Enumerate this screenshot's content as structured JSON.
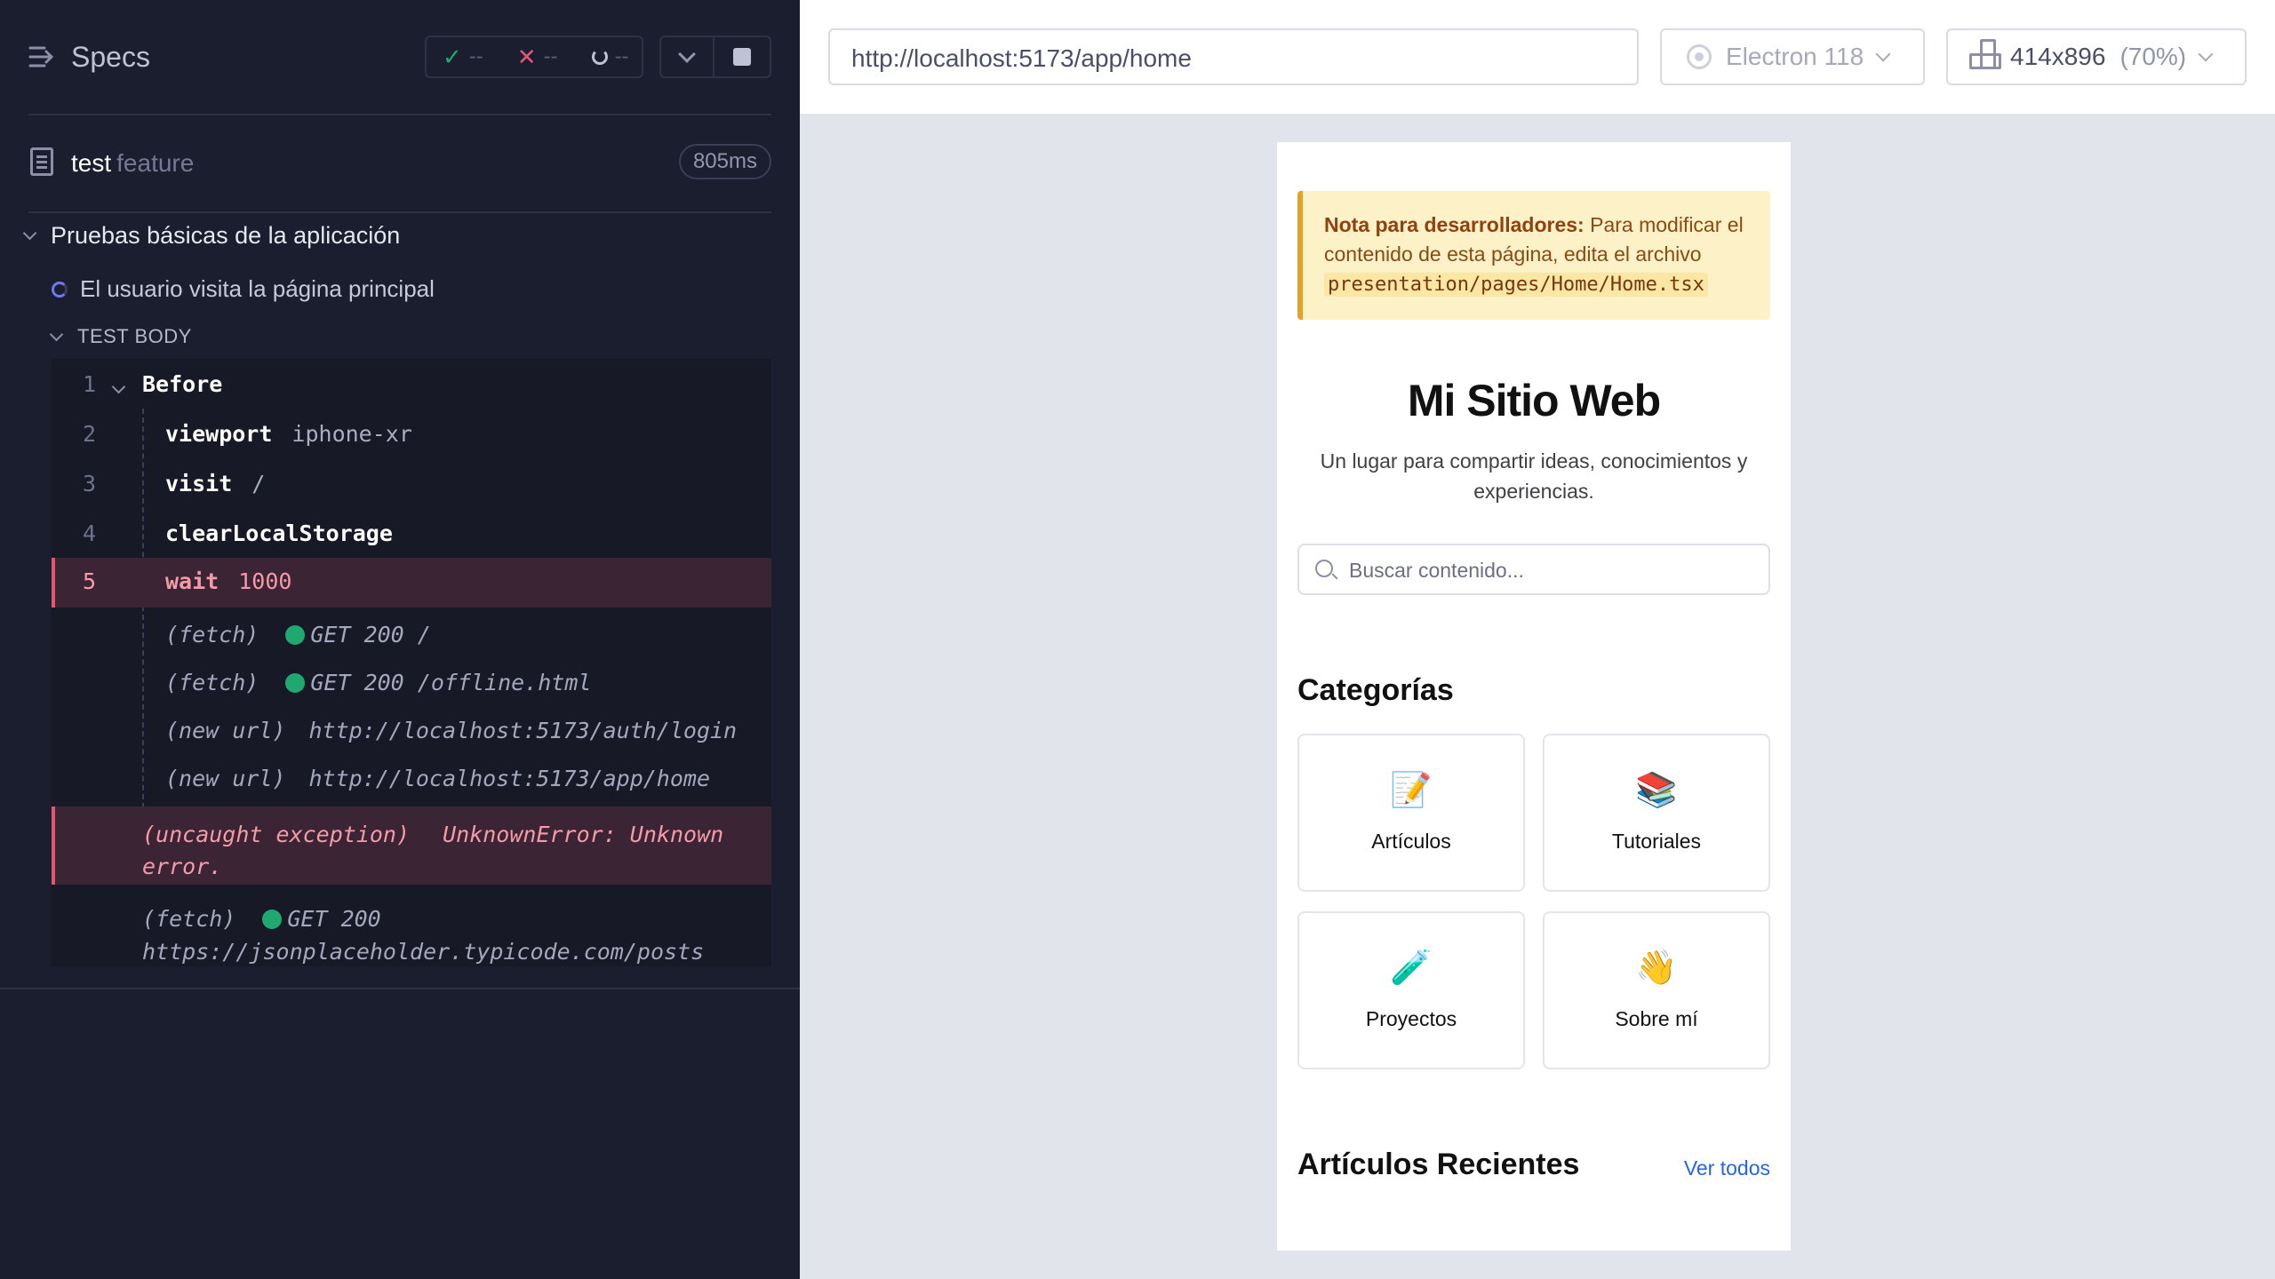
{
  "reporter": {
    "title": "Specs",
    "stats": {
      "passed": "--",
      "failed": "--",
      "pending": "--"
    },
    "file": {
      "name": "test",
      "ext": "feature",
      "duration": "805ms"
    },
    "suite": "Pruebas básicas de la aplicación",
    "test": "El usuario visita la página principal",
    "body_label": "TEST BODY",
    "commands": [
      {
        "num": "1",
        "name": "Before",
        "arg": ""
      },
      {
        "num": "2",
        "name": "viewport",
        "arg": "iphone-xr"
      },
      {
        "num": "3",
        "name": "visit",
        "arg": "/"
      },
      {
        "num": "4",
        "name": "clearLocalStorage",
        "arg": ""
      },
      {
        "num": "5",
        "name": "wait",
        "arg": "1000"
      }
    ],
    "events": [
      {
        "kind": "(fetch)",
        "text": "GET 200 /"
      },
      {
        "kind": "(fetch)",
        "text": "GET 200 /offline.html"
      },
      {
        "kind": "(new url)",
        "text": "http://localhost:5173/auth/login"
      },
      {
        "kind": "(new url)",
        "text": "http://localhost:5173/app/home"
      }
    ],
    "exception": {
      "kind": "(uncaught exception)",
      "text": "UnknownError: Unknown",
      "text2": "error."
    },
    "last_fetch": {
      "kind": "(fetch)",
      "text": "GET 200",
      "url": "https://jsonplaceholder.typicode.com/posts"
    }
  },
  "aut": {
    "url": "http://localhost:5173/app/home",
    "browser": "Electron 118",
    "viewport": "414x896",
    "zoom": "(70%)"
  },
  "site": {
    "note_bold": "Nota para desarrolladores:",
    "note_text": " Para modificar el contenido de esta página, edita el archivo ",
    "note_code": "presentation/pages/Home/Home.tsx",
    "title": "Mi Sitio Web",
    "subtitle": "Un lugar para compartir ideas, conocimientos y experiencias.",
    "search_placeholder": "Buscar contenido...",
    "categories_title": "Categorías",
    "categories": [
      {
        "emoji": "📝",
        "label": "Artículos"
      },
      {
        "emoji": "📚",
        "label": "Tutoriales"
      },
      {
        "emoji": "🧪",
        "label": "Proyectos"
      },
      {
        "emoji": "👋",
        "label": "Sobre mí"
      }
    ],
    "recent_title": "Artículos Recientes",
    "see_all": "Ver todos"
  }
}
